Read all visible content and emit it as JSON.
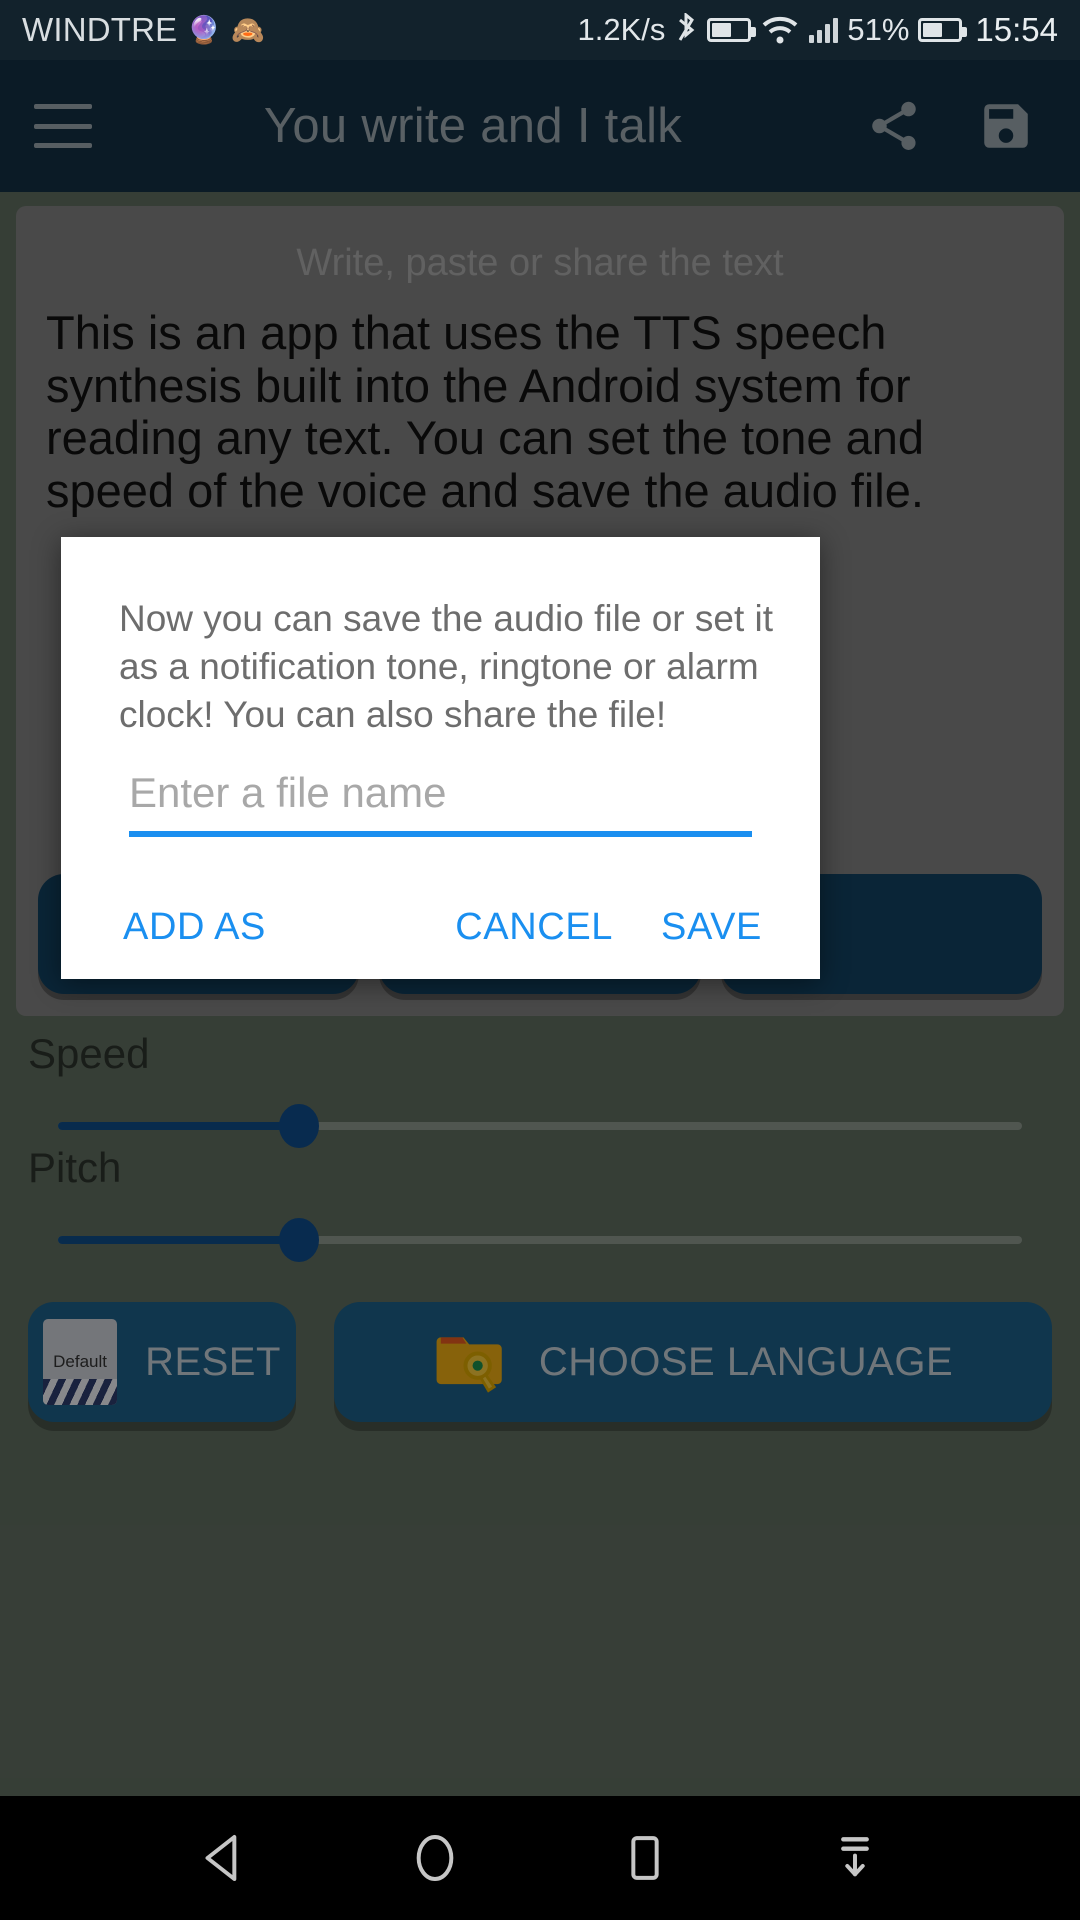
{
  "status_bar": {
    "carrier": "WINDTRE",
    "emoji_1": "🔮",
    "emoji_2": "🙈",
    "net_speed": "1.2K/s",
    "battery_percent": "51%",
    "clock": "15:54",
    "icons": [
      "bluetooth-icon",
      "wifi-icon",
      "cellular-signal-icon",
      "battery-icon"
    ]
  },
  "app_bar": {
    "title": "You write and I talk",
    "menu_icon": "hamburger-menu-icon",
    "share_icon": "share-icon",
    "save_icon": "floppy-disk-save-icon"
  },
  "editor": {
    "hint": "Write, paste or share the text",
    "body": "This is an app that uses the TTS speech synthesis built into the Android system for reading any text. You can set the tone and speed of the voice and save the audio file."
  },
  "controls": {
    "speed_label": "Speed",
    "speed_value": 25,
    "pitch_label": "Pitch",
    "pitch_value": 25,
    "reset_label": "RESET",
    "reset_icon_text": "Default",
    "choose_language_label": "CHOOSE LANGUAGE",
    "choose_language_icon": "folder-search-icon"
  },
  "dialog": {
    "message": "Now you can save the audio file or set it as a notification tone, ringtone or alarm clock! You can also share the file!",
    "input_value": "",
    "input_placeholder": "Enter a file name",
    "add_as_label": "ADD AS",
    "cancel_label": "CANCEL",
    "save_label": "SAVE",
    "accent_color": "#1a8ff0"
  },
  "nav_bar": {
    "back_icon": "back-triangle-icon",
    "home_icon": "home-circle-icon",
    "recents_icon": "recents-square-icon",
    "hide_nav_icon": "hide-navbar-arrow-icon"
  }
}
